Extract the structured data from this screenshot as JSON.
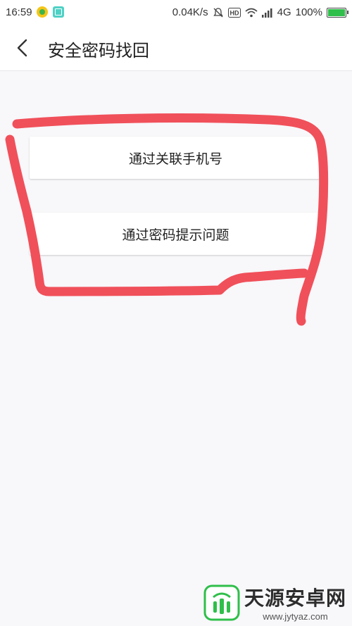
{
  "status_bar": {
    "time": "16:59",
    "speed": "0.04K/s",
    "network": "4G",
    "battery": "100%"
  },
  "header": {
    "title": "安全密码找回"
  },
  "options": [
    {
      "label": "通过关联手机号"
    },
    {
      "label": "通过密码提示问题"
    }
  ],
  "watermark": {
    "name": "天源安卓网",
    "url": "www.jytyaz.com"
  },
  "colors": {
    "annotation": "#f0505a",
    "accent_green": "#2fbf4a",
    "background": "#f8f7fa"
  }
}
